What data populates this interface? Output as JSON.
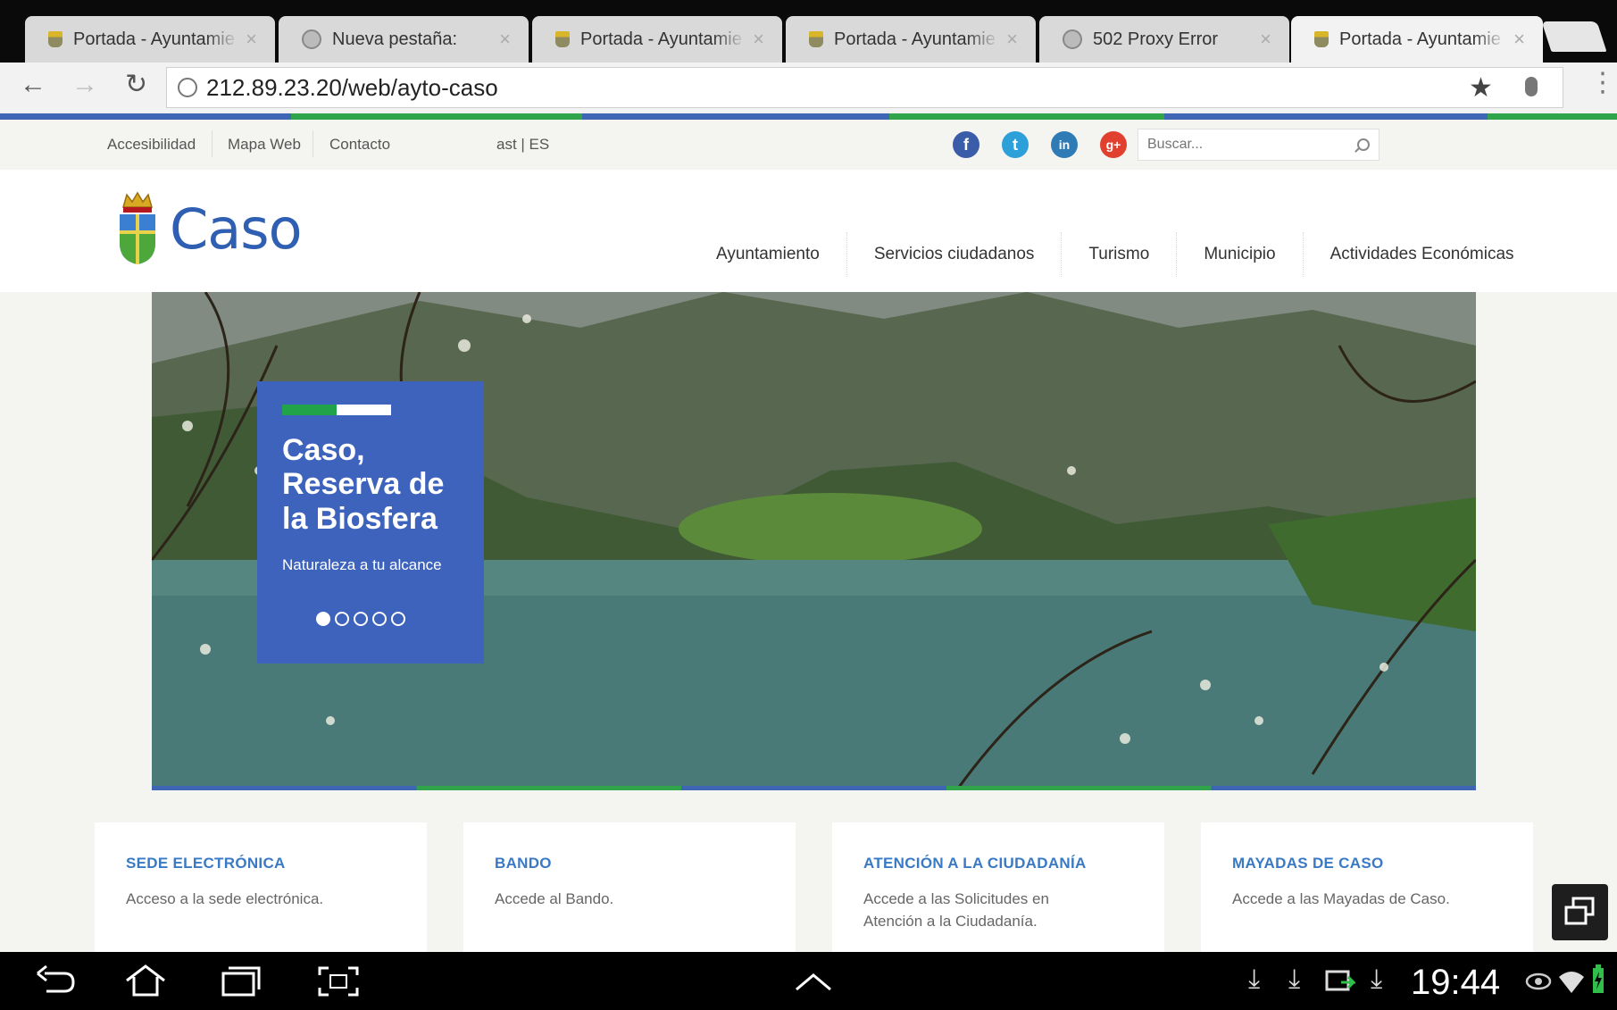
{
  "browser": {
    "tabs": [
      {
        "title": "Portada - Ayuntamie",
        "icon": "crest-favicon-icon",
        "active": false
      },
      {
        "title": "Nueva pestaña:",
        "icon": "globe-icon",
        "active": false
      },
      {
        "title": "Portada - Ayuntamie",
        "icon": "crest-favicon-icon",
        "active": false
      },
      {
        "title": "Portada - Ayuntamie",
        "icon": "crest-favicon-icon",
        "active": false
      },
      {
        "title": "502 Proxy Error",
        "icon": "globe-icon",
        "active": false
      },
      {
        "title": "Portada - Ayuntamie",
        "icon": "crest-favicon-icon",
        "active": true
      }
    ],
    "url": "212.89.23.20/web/ayto-caso"
  },
  "utility": {
    "links": [
      "Accesibilidad",
      "Mapa Web",
      "Contacto"
    ],
    "language": "ast | ES",
    "search_placeholder": "Buscar...",
    "social": [
      {
        "name": "facebook-icon",
        "glyph": "f",
        "color": "#3b5ca8"
      },
      {
        "name": "twitter-icon",
        "glyph": "t",
        "color": "#2d9fd9"
      },
      {
        "name": "linkedin-icon",
        "glyph": "in",
        "color": "#2f7bb6"
      },
      {
        "name": "google-plus-icon",
        "glyph": "g+",
        "color": "#e2402f"
      }
    ]
  },
  "header": {
    "logo_text": "Caso",
    "nav": [
      "Ayuntamiento",
      "Servicios ciudadanos",
      "Turismo",
      "Municipio",
      "Actividades Económicas"
    ]
  },
  "hero": {
    "title": "Caso, Reserva de la Biosfera",
    "subtitle": "Naturaleza a tu alcance",
    "slides_total": 5,
    "slide_active": 1
  },
  "cards": [
    {
      "title": "SEDE ELECTRÓNICA",
      "desc": "Acceso a la sede electrónica."
    },
    {
      "title": "BANDO",
      "desc": "Accede al Bando."
    },
    {
      "title": "ATENCIÓN A LA CIUDADANÍA",
      "desc": "Accede a las Solicitudes en Atención a la Ciudadanía."
    },
    {
      "title": "MAYADAS DE CASO",
      "desc": "Accede a las Mayadas de Caso."
    }
  ],
  "system": {
    "clock": "19:44"
  },
  "colors": {
    "brand_blue": "#2f5fb3",
    "card_blue": "#3d63bd",
    "accent_green": "#21a34a"
  }
}
